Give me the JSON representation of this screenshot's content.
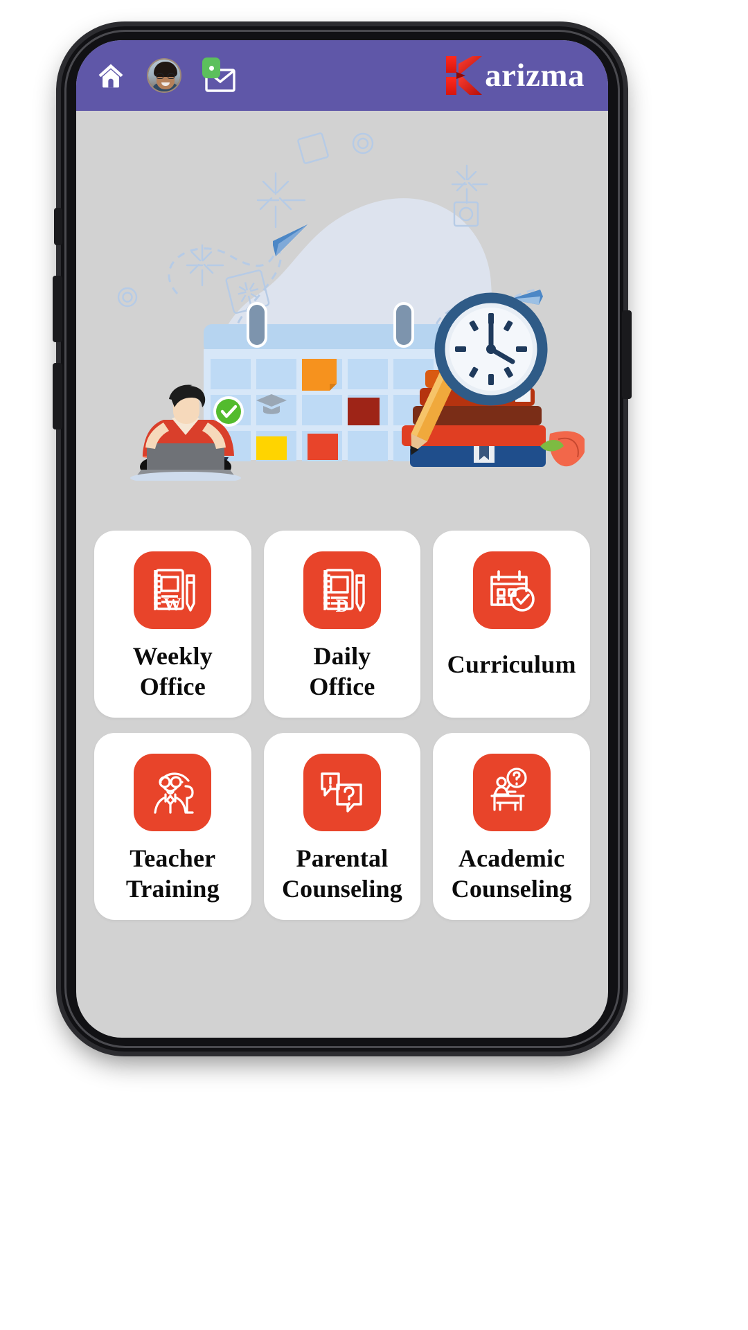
{
  "app": {
    "brand_letter": "K",
    "brand_name": "arizma",
    "header_bg": "#5f57a8",
    "accent": "#E8442A",
    "screen_bg": "#d2d2d2",
    "card_bg": "#ffffff"
  },
  "header": {
    "home_icon": "home-icon",
    "avatar_icon": "user-avatar",
    "mail_icon": "mail-icon",
    "mail_badge_icon": "notification-dot"
  },
  "hero": {
    "illustration_name": "student-planning-calendar-illustration",
    "elements": [
      "person-with-laptop",
      "wall-calendar",
      "wall-clock",
      "stack-of-books",
      "pencil",
      "sticky-notes",
      "green-check-badge",
      "paper-plane-arrows"
    ]
  },
  "tiles": [
    {
      "id": "weekly-office",
      "label": "Weekly\nOffice",
      "icon": "weekly-notebook-icon"
    },
    {
      "id": "daily-office",
      "label": "Daily\nOffice",
      "icon": "daily-notebook-icon"
    },
    {
      "id": "curriculum",
      "label": "Curriculum",
      "icon": "calendar-check-icon"
    },
    {
      "id": "teacher-training",
      "label": "Teacher\nTraining",
      "icon": "teacher-pointer-icon"
    },
    {
      "id": "parental-counseling",
      "label": "Parental\nCounseling",
      "icon": "chat-question-icon"
    },
    {
      "id": "academic-counseling",
      "label": "Academic\nCounseling",
      "icon": "student-desk-question-icon"
    }
  ]
}
